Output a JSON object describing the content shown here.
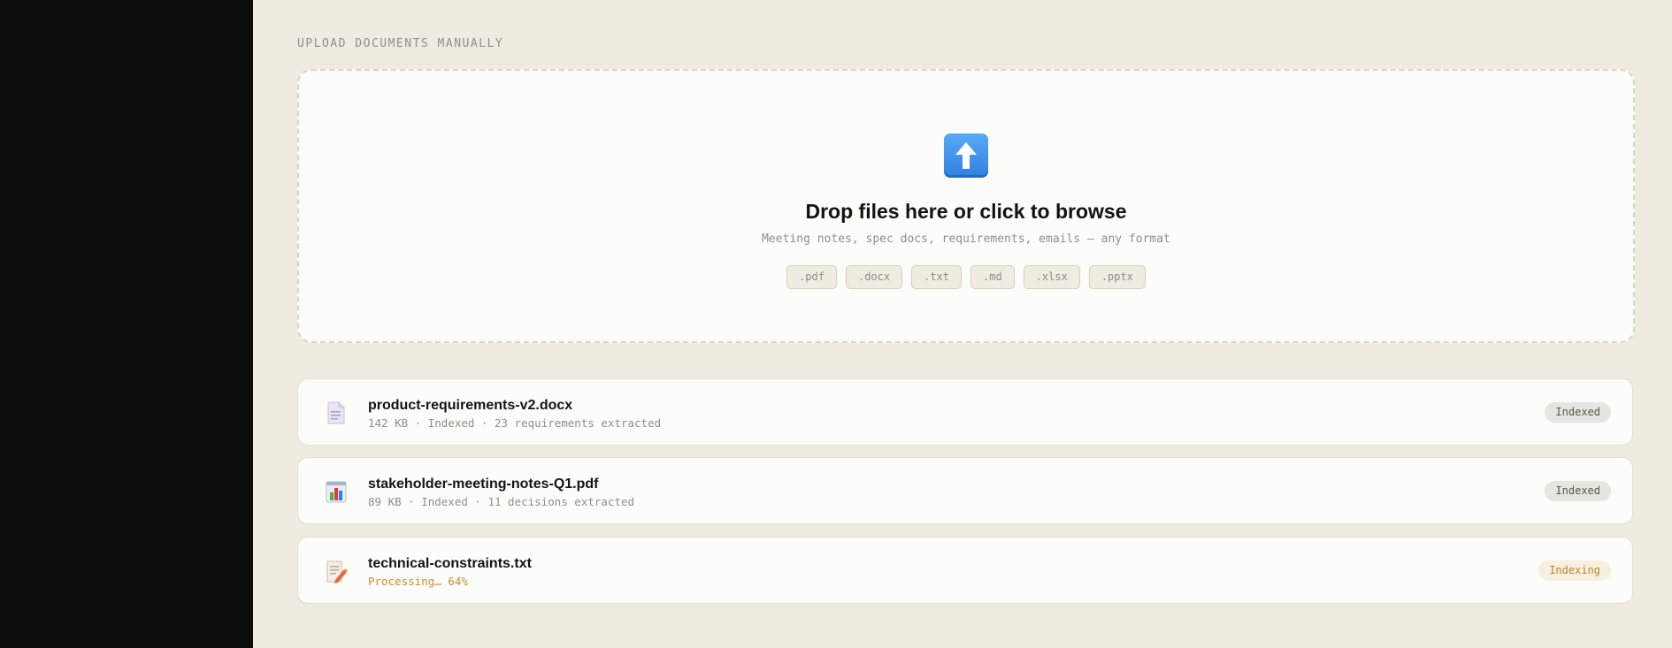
{
  "section": {
    "label": "UPLOAD DOCUMENTS MANUALLY"
  },
  "dropzone": {
    "icon": "upload-arrow-icon",
    "title": "Drop files here or click to browse",
    "subtitle": "Meeting notes, spec docs, requirements, emails — any format",
    "formats": [
      ".pdf",
      ".docx",
      ".txt",
      ".md",
      ".xlsx",
      ".pptx"
    ]
  },
  "files": [
    {
      "icon": "document-icon",
      "name": "product-requirements-v2.docx",
      "meta": "142 KB · Indexed · 23 requirements extracted",
      "status": "Indexed"
    },
    {
      "icon": "bar-chart-icon",
      "name": "stakeholder-meeting-notes-Q1.pdf",
      "meta": "89 KB · Indexed · 11 decisions extracted",
      "status": "Indexed"
    },
    {
      "icon": "memo-icon",
      "name": "technical-constraints.txt",
      "meta": "Processing… 64%",
      "status": "Indexing",
      "progress": 64
    }
  ],
  "colors": {
    "background": "#efebe1",
    "sidebar": "#0d0d0d",
    "card": "#fcfcf8",
    "processing": "#c8903a",
    "upload_icon": "#3b8ceb"
  }
}
